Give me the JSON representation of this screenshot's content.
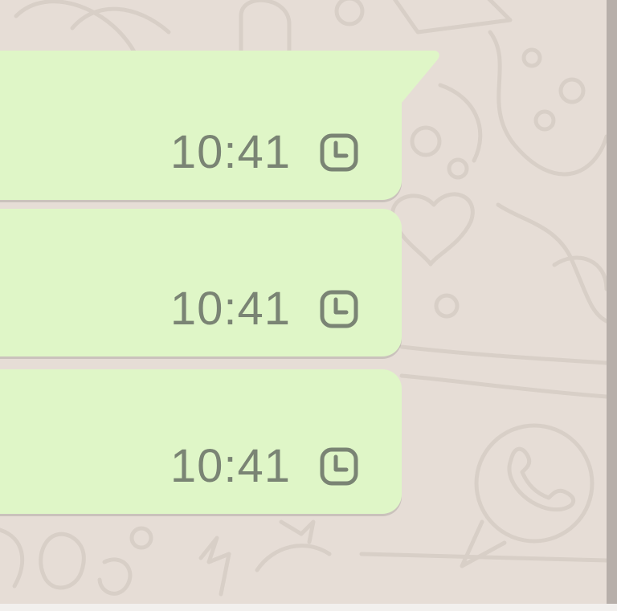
{
  "messages": [
    {
      "time": "10:41",
      "status_icon": "clock-pending-icon"
    },
    {
      "time": "10:41",
      "status_icon": "clock-pending-icon"
    },
    {
      "time": "10:41",
      "status_icon": "clock-pending-icon"
    }
  ],
  "colors": {
    "chat_background": "#e6ddd6",
    "outgoing_bubble": "#dff6c7",
    "meta_text": "#7a8474",
    "wallpaper_doodle": "#d7cec6",
    "scroll_edge": "#b7afaa"
  }
}
